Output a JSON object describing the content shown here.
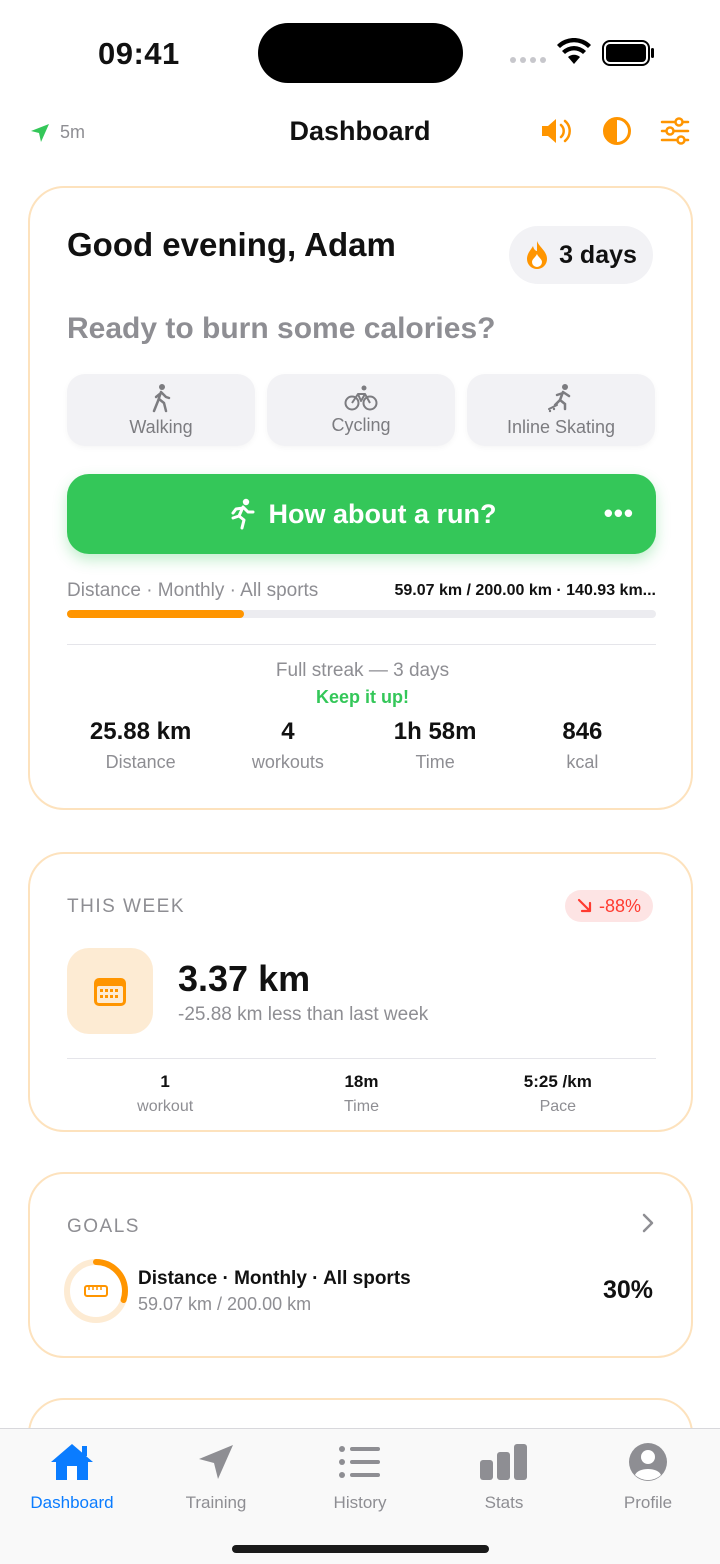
{
  "status_bar": {
    "time": "09:41"
  },
  "header": {
    "location_label": "5m",
    "title": "Dashboard",
    "icons": [
      "sound-icon",
      "contrast-icon",
      "sliders-icon"
    ]
  },
  "hero": {
    "greeting": "Good evening, Adam",
    "streak_badge": "3 days",
    "prompt": "Ready to burn some calories?",
    "sports": [
      {
        "label": "Walking",
        "icon": "walking-icon"
      },
      {
        "label": "Cycling",
        "icon": "cycling-icon"
      },
      {
        "label": "Inline Skating",
        "icon": "skating-icon"
      }
    ],
    "run_button": "How about a run?",
    "goal": {
      "label": "Distance · Monthly · All sports",
      "value": "59.07 km / 200.00 km · 140.93 km...",
      "progress": 0.3
    },
    "full_streak": "Full streak — 3 days",
    "keep_it_up": "Keep it up!",
    "stats": [
      {
        "value": "25.88 km",
        "label": "Distance"
      },
      {
        "value": "4",
        "label": "workouts"
      },
      {
        "value": "1h 58m",
        "label": "Time"
      },
      {
        "value": "846",
        "label": "kcal"
      }
    ]
  },
  "this_week": {
    "title": "THIS WEEK",
    "delta": "-88%",
    "distance": "3.37 km",
    "comparison": "-25.88 km less than last week",
    "stats": [
      {
        "value": "1",
        "label": "workout"
      },
      {
        "value": "18m",
        "label": "Time"
      },
      {
        "value": "5:25 /km",
        "label": "Pace"
      }
    ]
  },
  "goals": {
    "title": "GOALS",
    "item": {
      "name": "Distance · Monthly · All sports",
      "values": "59.07 km / 200.00 km",
      "percent": "30%",
      "progress": 0.3
    }
  },
  "tabs": [
    {
      "label": "Dashboard",
      "icon": "home-icon",
      "active": true
    },
    {
      "label": "Training",
      "icon": "navigation-arrow-icon",
      "active": false
    },
    {
      "label": "History",
      "icon": "list-icon",
      "active": false
    },
    {
      "label": "Stats",
      "icon": "bar-chart-icon",
      "active": false
    },
    {
      "label": "Profile",
      "icon": "person-icon",
      "active": false
    }
  ],
  "colors": {
    "accent_orange": "#ff9500",
    "accent_green": "#34c759",
    "accent_blue": "#0a7cff",
    "negative_red": "#ff3b30",
    "card_border": "#fde2bd"
  }
}
